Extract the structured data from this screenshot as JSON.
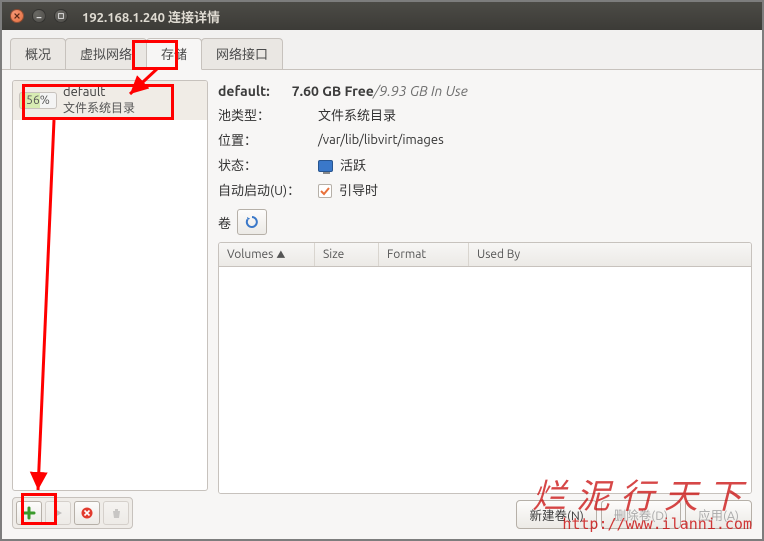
{
  "window": {
    "title": "192.168.1.240 连接详情"
  },
  "tabs": [
    {
      "label": "概况"
    },
    {
      "label": "虚拟网络"
    },
    {
      "label": "存储",
      "active": true
    },
    {
      "label": "网络接口"
    }
  ],
  "pools": [
    {
      "name": "default",
      "type": "文件系统目录",
      "usage_text": "56%"
    }
  ],
  "details": {
    "title_name": "default:",
    "free_text": "7.60 GB Free",
    "sep": " / ",
    "used_text": "9.93 GB In Use",
    "rows": {
      "pool_type_label": "池类型：",
      "pool_type_value": "文件系统目录",
      "location_label": "位置：",
      "location_value": "/var/lib/libvirt/images",
      "state_label": "状态：",
      "state_value": "活跃",
      "autostart_label": "自动启动(U)：",
      "autostart_value": "引导时",
      "volumes_label": "卷"
    }
  },
  "volumes_table": {
    "headers": [
      "Volumes",
      "Size",
      "Format",
      "Used By"
    ]
  },
  "footer": {
    "new_volume": "新建卷(N)",
    "delete_volume": "删除卷(D)",
    "apply": "应用(A)"
  },
  "watermark": {
    "line1": "烂泥行天下",
    "line2": "http://www.ilanni.com"
  }
}
